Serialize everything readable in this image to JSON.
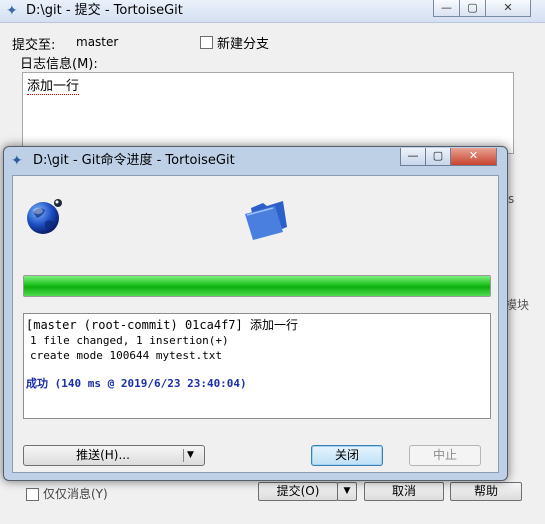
{
  "bg_window": {
    "title": "D:\\git - 提交 - TortoiseGit",
    "caption_buttons": {
      "minimize": "—",
      "maximize": "▢",
      "close": "✕"
    },
    "commit_to_label": "提交至:",
    "branch": "master",
    "new_branch_label": "新建分支",
    "message_label": "日志信息(M):",
    "message_text": "添加一行",
    "right_fragment_1": "s",
    "right_fragment_2": "模块",
    "message_only_label": "仅仅消息(Y)",
    "commit_button": "提交(O)",
    "commit_arrow": "▼",
    "cancel_button": "取消",
    "help_button": "帮助"
  },
  "dialog": {
    "title": "D:\\git - Git命令进度 - TortoiseGit",
    "caption_buttons": {
      "minimize": "—",
      "maximize": "▢",
      "close": "✕"
    },
    "progress_fraction": 1.0,
    "log": {
      "line1": "[master (root-commit) 01ca4f7] 添加一行",
      "line2": "1 file changed, 1 insertion(+)",
      "line3": "create mode 100644 mytest.txt",
      "success": "成功 (140 ms @ 2019/6/23 23:40:04)"
    },
    "push_button": "推送(H)...",
    "push_arrow": "▼",
    "close_button": "关闭",
    "abort_button": "中止"
  },
  "colors": {
    "progress": "#1bc11b",
    "success_text": "#1a2ea8",
    "dialog_frame": "#bdd0e6"
  }
}
